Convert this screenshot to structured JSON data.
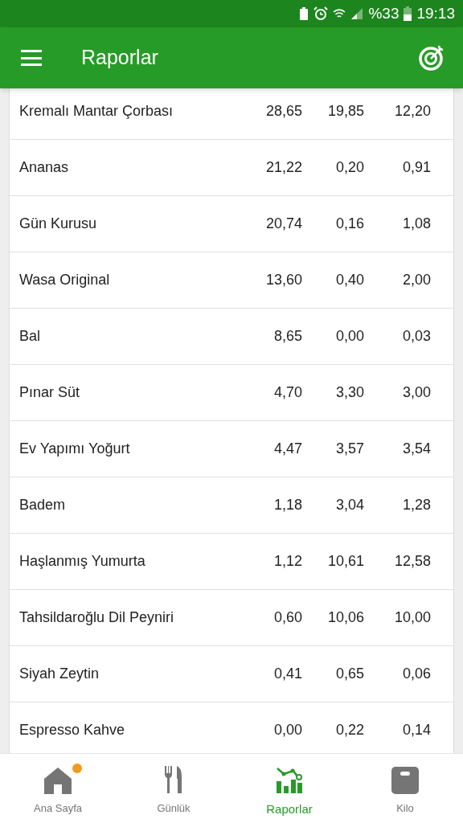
{
  "status_bar": {
    "battery_percent": "%33",
    "time": "19:13"
  },
  "app_bar": {
    "title": "Raporlar"
  },
  "table": {
    "rows": [
      {
        "name": "Kremalı Mantar Çorbası",
        "column_2": "28,65",
        "column_3": "19,85",
        "column_4": "12,20"
      },
      {
        "name": "Ananas",
        "column_2": "21,22",
        "column_3": "0,20",
        "column_4": "0,91"
      },
      {
        "name": "Gün Kurusu",
        "column_2": "20,74",
        "column_3": "0,16",
        "column_4": "1,08"
      },
      {
        "name": "Wasa Original",
        "column_2": "13,60",
        "column_3": "0,40",
        "column_4": "2,00"
      },
      {
        "name": "Bal",
        "column_2": "8,65",
        "column_3": "0,00",
        "column_4": "0,03"
      },
      {
        "name": "Pınar Süt",
        "column_2": "4,70",
        "column_3": "3,30",
        "column_4": "3,00"
      },
      {
        "name": "Ev Yapımı Yoğurt",
        "column_2": "4,47",
        "column_3": "3,57",
        "column_4": "3,54"
      },
      {
        "name": "Badem",
        "column_2": "1,18",
        "column_3": "3,04",
        "column_4": "1,28"
      },
      {
        "name": "Haşlanmış Yumurta",
        "column_2": "1,12",
        "column_3": "10,61",
        "column_4": "12,58"
      },
      {
        "name": "Tahsildaroğlu Dil Peyniri",
        "column_2": "0,60",
        "column_3": "10,06",
        "column_4": "10,00"
      },
      {
        "name": "Siyah Zeytin",
        "column_2": "0,41",
        "column_3": "0,65",
        "column_4": "0,06"
      },
      {
        "name": "Espresso Kahve",
        "column_2": "0,00",
        "column_3": "0,22",
        "column_4": "0,14"
      }
    ]
  },
  "bottom_nav": [
    {
      "kind": "home",
      "label": "Ana Sayfa",
      "selected": false,
      "badge": true
    },
    {
      "kind": "diary",
      "label": "Günlük",
      "selected": false,
      "badge": false
    },
    {
      "kind": "reports",
      "label": "Raporlar",
      "selected": true,
      "badge": false
    },
    {
      "kind": "weight",
      "label": "Kilo",
      "selected": false,
      "badge": false
    }
  ]
}
